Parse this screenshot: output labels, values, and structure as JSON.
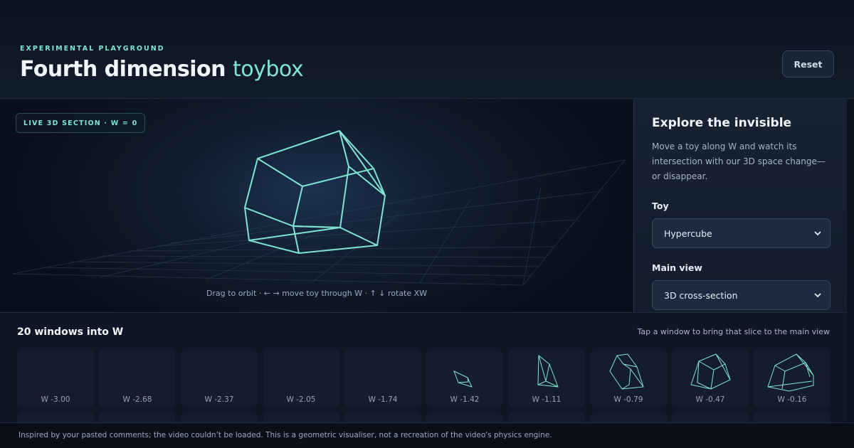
{
  "header": {
    "eyebrow": "EXPERIMENTAL PLAYGROUND",
    "title_main": "Fourth dimension",
    "title_accent": "toybox",
    "reset_label": "Reset"
  },
  "stage": {
    "badge": "LIVE 3D SECTION · W = 0",
    "hint": "Drag to orbit · ← → move toy through W · ↑ ↓ rotate XW",
    "w_value": 0
  },
  "panel": {
    "title": "Explore the invisible",
    "description": "Move a toy along W and watch its intersection with our 3D space change—or disappear.",
    "toy_label": "Toy",
    "toy_value": "Hypercube",
    "view_label": "Main view",
    "view_value": "3D cross-section"
  },
  "windows": {
    "title": "20 windows into W",
    "hint": "Tap a window to bring that slice to the main view",
    "items": [
      {
        "label": "W -3.00",
        "w": -3.0
      },
      {
        "label": "W -2.68",
        "w": -2.68
      },
      {
        "label": "W -2.37",
        "w": -2.37
      },
      {
        "label": "W -2.05",
        "w": -2.05
      },
      {
        "label": "W -1.74",
        "w": -1.74
      },
      {
        "label": "W -1.42",
        "w": -1.42
      },
      {
        "label": "W -1.11",
        "w": -1.11
      },
      {
        "label": "W -0.79",
        "w": -0.79
      },
      {
        "label": "W -0.47",
        "w": -0.47
      },
      {
        "label": "W -0.16",
        "w": -0.16
      }
    ]
  },
  "footer": {
    "text": "Inspired by your pasted comments; the video couldn’t be loaded. This is a geometric visualiser, not a recreation of the video's physics engine."
  },
  "colors": {
    "accent": "#7fe5d2",
    "background": "#0d1320",
    "panel": "#172233"
  },
  "icons": {
    "select_chevron": "chevron-down-icon"
  }
}
